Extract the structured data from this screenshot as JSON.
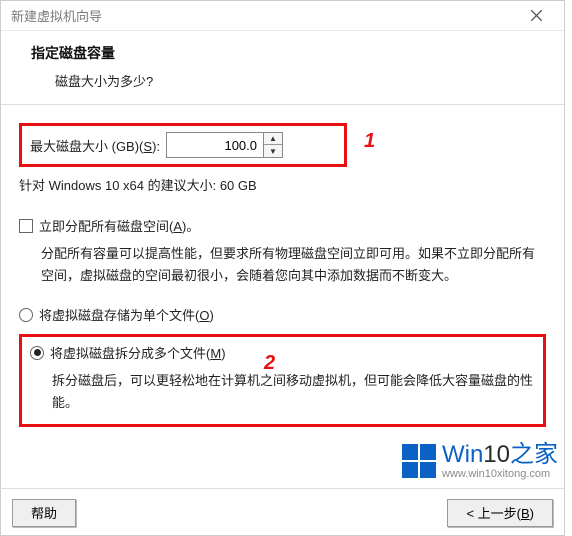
{
  "window": {
    "title": "新建虚拟机向导"
  },
  "header": {
    "title": "指定磁盘容量",
    "subtitle": "磁盘大小为多少?"
  },
  "diskSize": {
    "label_prefix": "最大磁盘大小 (GB)(",
    "label_key": "S",
    "label_suffix": "):",
    "value": "100.0"
  },
  "recommended": "针对 Windows 10 x64 的建议大小: 60 GB",
  "allocateNow": {
    "label_prefix": "立即分配所有磁盘空间(",
    "label_key": "A",
    "label_suffix": ")。",
    "desc": "分配所有容量可以提高性能，但要求所有物理磁盘空间立即可用。如果不立即分配所有空间，虚拟磁盘的空间最初很小，会随着您向其中添加数据而不断变大。"
  },
  "storeSingle": {
    "label_prefix": "将虚拟磁盘存储为单个文件(",
    "label_key": "O",
    "label_suffix": ")"
  },
  "splitMultiple": {
    "label_prefix": "将虚拟磁盘拆分成多个文件(",
    "label_key": "M",
    "label_suffix": ")",
    "desc": "拆分磁盘后，可以更轻松地在计算机之间移动虚拟机，但可能会降低大容量磁盘的性能。"
  },
  "annotations": {
    "a1": "1",
    "a2": "2"
  },
  "footer": {
    "help": "帮助",
    "back_prefix": "< 上一步(",
    "back_key": "B",
    "back_suffix": ")"
  },
  "logo": {
    "win": "Win",
    "ten": "10",
    "zhi": "之家",
    "url": "www.win10xitong.com"
  }
}
